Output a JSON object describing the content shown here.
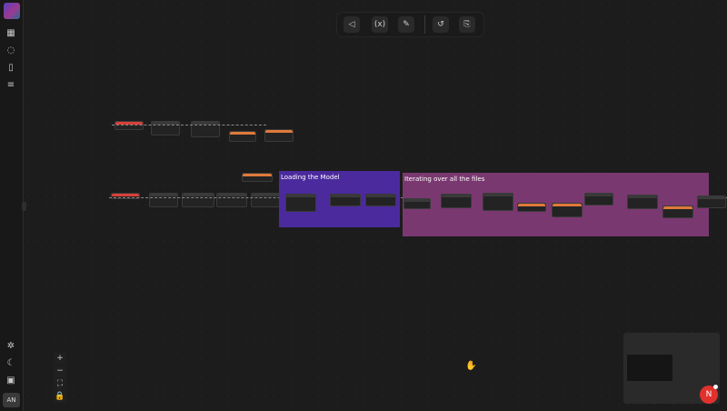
{
  "app": {
    "avatar_initials": "AN",
    "logo": "app-logo"
  },
  "sidebar": {
    "top_icons": [
      "grid-icon",
      "chat-icon",
      "book-icon",
      "sliders-icon"
    ],
    "bottom_icons": [
      "bug-icon",
      "moon-icon",
      "panel-icon"
    ]
  },
  "toolbar": {
    "buttons": [
      "speaker-icon",
      "variable-icon",
      "edit-icon",
      "history-icon",
      "export-icon"
    ]
  },
  "groups": [
    {
      "title": "Loading the Model",
      "color": "#4b2a9e"
    },
    {
      "title": "Iterating over all the files",
      "color": "#7a3870"
    }
  ],
  "zoom_controls": [
    "+",
    "−",
    "⛶",
    "🔒"
  ],
  "colors": {
    "canvas": "#1c1c1c",
    "node": "#232323",
    "accent_orange": "#e07a3a",
    "accent_red": "#d8403a"
  }
}
